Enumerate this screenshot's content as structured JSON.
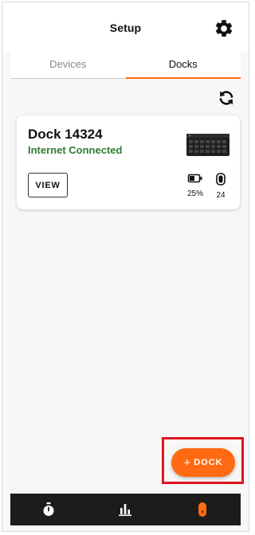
{
  "header": {
    "title": "Setup",
    "settings_icon": "gear-icon"
  },
  "tabs": [
    {
      "label": "Devices",
      "active": false
    },
    {
      "label": "Docks",
      "active": true
    }
  ],
  "refresh_icon": "refresh-icon",
  "dock_card": {
    "name": "Dock 14324",
    "status": "Internet Connected",
    "view_label": "VIEW",
    "battery_percent": "25%",
    "device_count": "24",
    "image_icon": "dock-device-image",
    "battery_icon": "battery-icon",
    "device_icon": "device-tag-icon"
  },
  "fab": {
    "plus": "+",
    "label": "DOCK"
  },
  "bottom_nav": [
    {
      "icon": "stopwatch-icon",
      "active": false
    },
    {
      "icon": "bar-chart-icon",
      "active": false
    },
    {
      "icon": "device-tag-icon",
      "active": true
    }
  ],
  "colors": {
    "accent": "#ff6a13",
    "status_green": "#2f7d32",
    "nav_background": "#1c1c1c",
    "highlight_red": "#e0141e"
  }
}
